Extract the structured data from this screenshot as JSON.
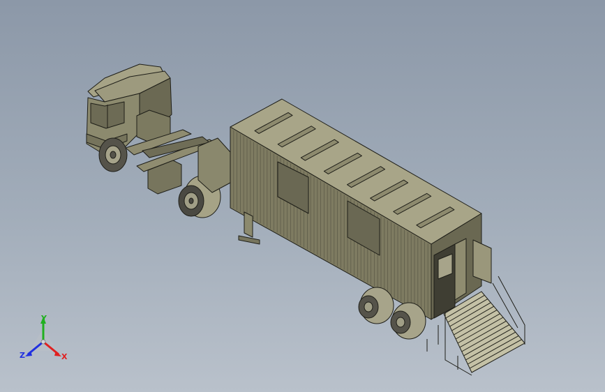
{
  "triad": {
    "x_label": "X",
    "y_label": "Y",
    "z_label": "Z",
    "x_color": "#e02020",
    "y_color": "#20b020",
    "z_color": "#2030e0"
  },
  "model": {
    "body_color": "#807d63",
    "body_dark": "#5e5c49",
    "body_light": "#a6a386",
    "edge_color": "#1e1e18"
  }
}
